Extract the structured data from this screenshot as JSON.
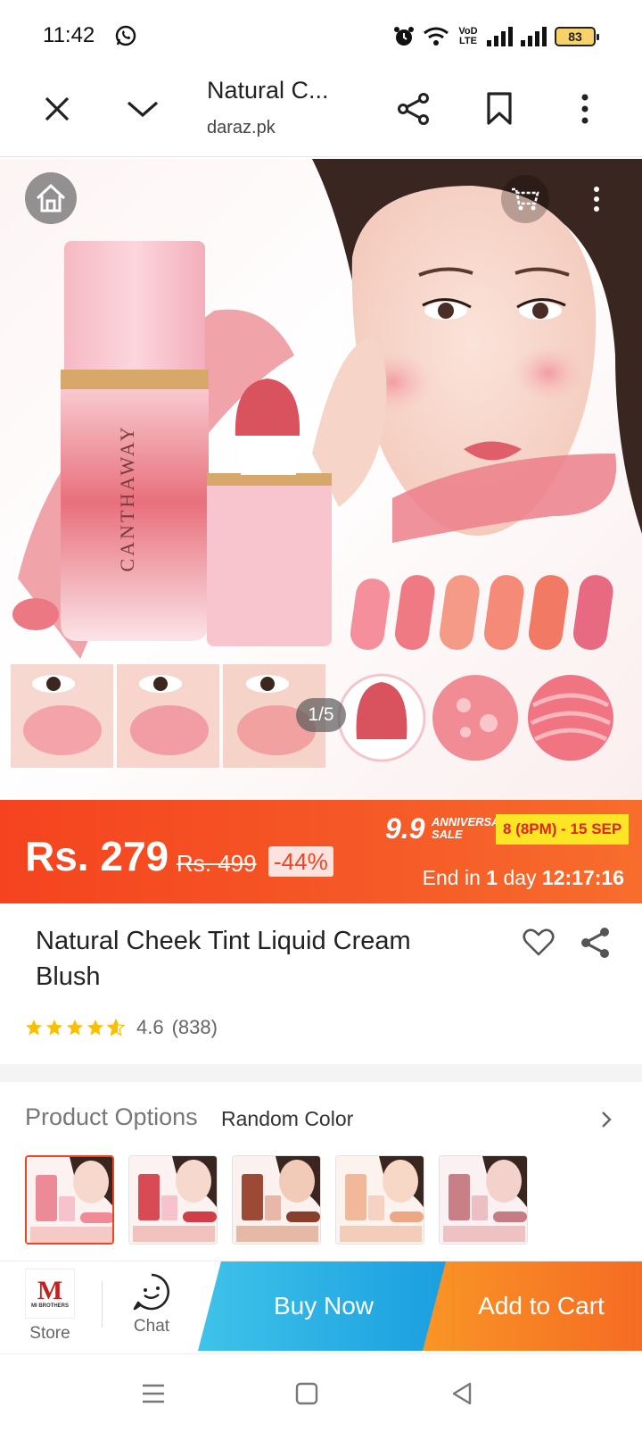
{
  "status_bar": {
    "time": "11:42",
    "network_label": "VoD LTE",
    "battery": "83"
  },
  "browser": {
    "title": "Natural C...",
    "url": "daraz.pk"
  },
  "product_image": {
    "page_indicator": "1/5",
    "brand_on_bottle": "CANTHAWAY"
  },
  "price": {
    "current": "Rs. 279",
    "original": "Rs. 499",
    "discount": "-44%"
  },
  "sale": {
    "logo_number": "9.9",
    "logo_text_line1": "ANNIVERSARY",
    "logo_text_line2": "SALE",
    "dates": "8 (8PM) - 15 SEP",
    "countdown_prefix": "End in",
    "countdown_days": "1",
    "countdown_days_label": "day",
    "countdown_time": "12:17:16"
  },
  "product": {
    "title": "Natural Cheek Tint Liquid Cream Blush",
    "rating": "4.6",
    "rating_count": "(838)",
    "stars": 4.6
  },
  "options": {
    "label": "Product Options",
    "value": "Random Color",
    "variant_count": 5
  },
  "action_bar": {
    "store_label": "Store",
    "store_logo_text": "MI BROTHERS",
    "chat_label": "Chat",
    "buy_now": "Buy Now",
    "add_to_cart": "Add to Cart"
  },
  "colors": {
    "brand_orange": "#f5431f",
    "buy_now_blue": "#1a9ee0",
    "add_cart_orange": "#f87a24",
    "sale_yellow": "#fbe524"
  }
}
